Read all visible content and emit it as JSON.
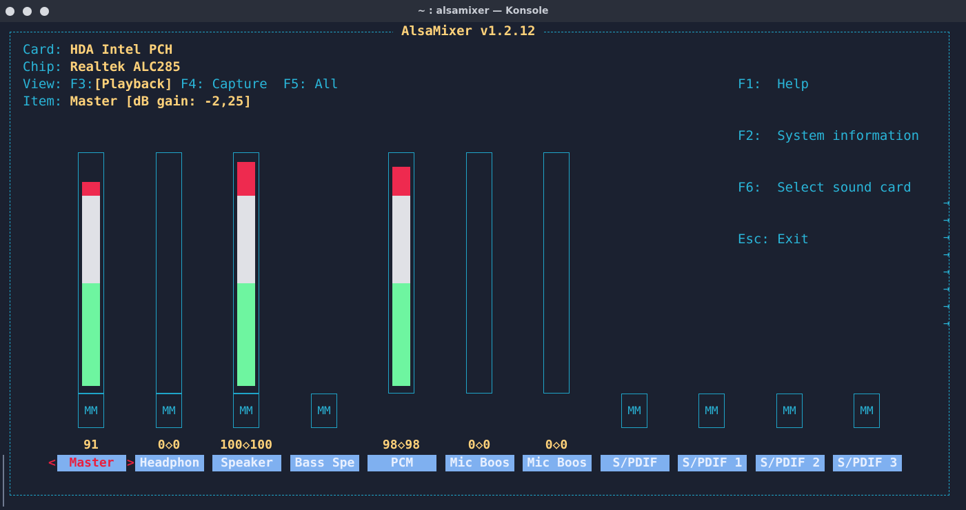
{
  "window": {
    "title": "~ : alsamixer — Konsole"
  },
  "mixer": {
    "title": "AlsaMixer v1.2.12",
    "card_label": "Card:",
    "card_value": "HDA Intel PCH",
    "chip_label": "Chip:",
    "chip_value": "Realtek ALC285",
    "view_label": "View:",
    "view_f3": "F3:",
    "view_playback": "[Playback]",
    "view_f4": "F4: Capture",
    "view_f5": "F5: All",
    "item_label": "Item:",
    "item_value": "Master [dB gain: -2,25]"
  },
  "fkeys": [
    {
      "key": "F1:",
      "desc": "Help"
    },
    {
      "key": "F2:",
      "desc": "System information"
    },
    {
      "key": "F6:",
      "desc": "Select sound card"
    },
    {
      "key": "Esc:",
      "desc": "Exit"
    }
  ],
  "channels": [
    {
      "name": "Master",
      "value": "91",
      "level": 0.91,
      "has_bar": true,
      "has_mute": true,
      "selected": true,
      "mute_label": "MM"
    },
    {
      "name": "Headphon",
      "value": "0<>0",
      "level": 0,
      "has_bar": true,
      "has_mute": true,
      "mute_label": "MM"
    },
    {
      "name": "Speaker",
      "value": "100<>100",
      "level": 1.0,
      "has_bar": true,
      "has_mute": true,
      "mute_label": "MM"
    },
    {
      "name": "Bass Spe",
      "value": "",
      "level": 0,
      "has_bar": false,
      "has_mute": true,
      "mute_label": "MM"
    },
    {
      "name": "PCM",
      "value": "98<>98",
      "level": 0.98,
      "has_bar": true,
      "has_mute": false
    },
    {
      "name": "Mic Boos",
      "value": "0<>0",
      "level": 0,
      "has_bar": true,
      "has_mute": false
    },
    {
      "name": "Mic Boos",
      "value": "0<>0",
      "level": 0,
      "has_bar": true,
      "has_mute": false
    },
    {
      "name": "S/PDIF",
      "value": "",
      "level": 0,
      "has_bar": false,
      "has_mute": true,
      "mute_label": "MM"
    },
    {
      "name": "S/PDIF 1",
      "value": "",
      "level": 0,
      "has_bar": false,
      "has_mute": true,
      "mute_label": "MM"
    },
    {
      "name": "S/PDIF 2",
      "value": "",
      "level": 0,
      "has_bar": false,
      "has_mute": true,
      "mute_label": "MM"
    },
    {
      "name": "S/PDIF 3",
      "value": "",
      "level": 0,
      "has_bar": false,
      "has_mute": true,
      "mute_label": "MM"
    }
  ],
  "colors": {
    "low": "#6ef5a0",
    "mid": "#e0e1e6",
    "high": "#ee2a4f",
    "border": "#1fa5c9",
    "accent": "#ffd27a"
  }
}
